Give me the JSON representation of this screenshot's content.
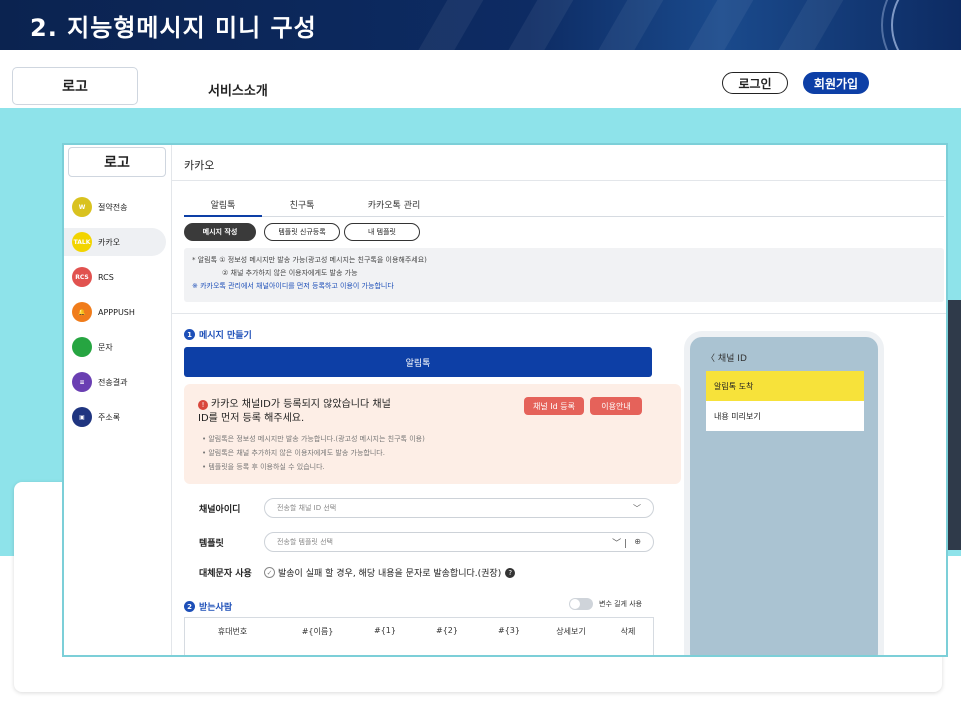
{
  "slide": {
    "title": "2. 지능형메시지 미니 구성"
  },
  "site": {
    "logo": "로고",
    "nav": "서비스소개",
    "login": "로그인",
    "join": "회원가입"
  },
  "sidebar": {
    "logo": "로고",
    "items": [
      {
        "label": "절약전송",
        "icon": "piggy-icon",
        "color": "#d9c21f",
        "glyph": "W"
      },
      {
        "label": "카카오",
        "icon": "kakao-talk-icon",
        "color": "#f2d400",
        "glyph": "TALK"
      },
      {
        "label": "RCS",
        "icon": "rcs-icon",
        "color": "#e1524f",
        "glyph": "RCS"
      },
      {
        "label": "APPPUSH",
        "icon": "bell-icon",
        "color": "#f07c1b",
        "glyph": "🔔"
      },
      {
        "label": "문자",
        "icon": "chat-bubble-icon",
        "color": "#26a541",
        "glyph": ""
      },
      {
        "label": "전송결과",
        "icon": "list-icon",
        "color": "#6a3fb2",
        "glyph": "≡"
      },
      {
        "label": "주소록",
        "icon": "contacts-icon",
        "color": "#1f3580",
        "glyph": "▣"
      }
    ]
  },
  "main": {
    "title": "카카오",
    "tabs": [
      "알림톡",
      "친구톡",
      "카카오톡 관리"
    ],
    "pills": [
      "메시지 작성",
      "템플릿 신규등록",
      "내 템플릿"
    ],
    "notice": {
      "line1": "* 알림톡 ① 정보성 메시지만 발송 가능(광고성 메시지는 친구톡을 이용해주세요)",
      "line2": "② 채널 추가하지 않은 이용자에게도 발송 가능",
      "line3": "※ 카카오톡 관리에서 채널아이디를 먼저 등록하고 이용이 가능합니다"
    },
    "section1": {
      "num": "1",
      "title": "메시지 만들기"
    },
    "alim_bar": "알림톡",
    "warning": {
      "title": "카카오 채널ID가 등록되지 않았습니다 채널ID를 먼저 등록 해주세요.",
      "btn_register": "채널 Id 등록",
      "btn_guide": "이용안내",
      "list": [
        "• 알림톡은 정보성 메시지만 발송 가능합니다.(광고성 메시지는 친구톡 이용)",
        "• 알림톡은 채널 추가하지 않은 이용자에게도 발송 가능합니다.",
        "• 템플릿을 등록 후 이용하실 수 있습니다."
      ]
    },
    "form": {
      "channel_label": "채널아이디",
      "channel_placeholder": "전송할 채널 ID 선택",
      "template_label": "템플릿",
      "template_placeholder": "전송할 템플릿 선택",
      "alt_label": "대체문자 사용",
      "alt_text": "발송이 실패 할 경우, 해당 내용을 문자로 발송합니다.(권장)"
    },
    "section2": {
      "num": "2",
      "title": "받는사람"
    },
    "toggle_label": "변수 길게 사용",
    "table_headers": [
      "휴대번호",
      "#{이름}",
      "#{1}",
      "#{2}",
      "#{3}",
      "상세보기",
      "삭제"
    ]
  },
  "phone": {
    "channel": "채널 ID",
    "head": "알림톡 도착",
    "body": "내용 미리보기"
  }
}
